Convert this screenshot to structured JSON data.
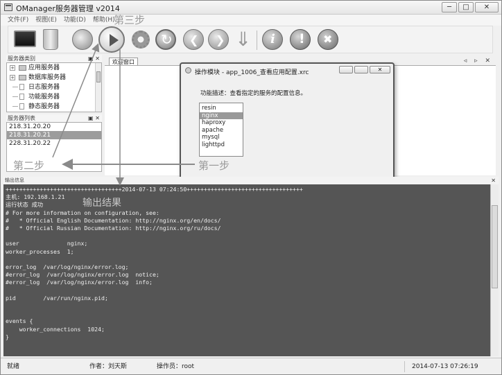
{
  "window": {
    "title": "OManager服务器管理 v2014",
    "controls": [
      "─",
      "□",
      "✕"
    ]
  },
  "menu": [
    "文件(F)",
    "视图(E)",
    "功能(D)",
    "帮助(H)"
  ],
  "toolbar": {
    "icons": [
      "monitor-icon",
      "trash-icon",
      "wrench-icon",
      "play-icon",
      "gear-icon",
      "refresh-icon",
      "back-icon",
      "forward-icon",
      "download-icon",
      "info-icon",
      "warning-icon",
      "stop-icon"
    ]
  },
  "annotations": {
    "step3": "第三步",
    "step2": "第二步",
    "step1": "第一步",
    "result": "输出结果"
  },
  "category_panel": {
    "title": "服务器类别",
    "ctrl": "▣ ✕",
    "items": [
      {
        "label": "应用服务器",
        "expander": "+",
        "type": "folder"
      },
      {
        "label": "数据库服务器",
        "expander": "+",
        "type": "folder"
      },
      {
        "label": "日志服务器",
        "expander": "",
        "type": "leaf"
      },
      {
        "label": "功能服务器",
        "expander": "",
        "type": "leaf"
      },
      {
        "label": "静态服务器",
        "expander": "",
        "type": "leaf"
      }
    ]
  },
  "server_list": {
    "title": "服务器列表",
    "ctrl": "▣ ✕",
    "items": [
      "218.31.20.20",
      "218.31.20.21",
      "228.31.20.22"
    ],
    "selected_index": 1
  },
  "tabs": {
    "active": "欢迎窗口",
    "controls": "◃ ▹ ✕"
  },
  "dialog": {
    "title": "操作模块 - app_1006_查看应用配置.xrc",
    "description": "功能描述：查看指定的服务的配置信息。",
    "close": "✕",
    "items": [
      "resin",
      "nginx",
      "haproxy",
      "apache",
      "mysql",
      "lighttpd"
    ],
    "selected_index": 1
  },
  "output": {
    "title": "输出信息",
    "ctrl": "✕",
    "lines": [
      "++++++++++++++++++++++++++++++++++2014-07-13 07:24:50++++++++++++++++++++++++++++++++++",
      "主机: 192.168.1.21",
      "运行状态 成功",
      "# For more information on configuration, see:",
      "#   * Official English Documentation: http://nginx.org/en/docs/",
      "#   * Official Russian Documentation: http://nginx.org/ru/docs/",
      "",
      "user              nginx;",
      "worker_processes  1;",
      "",
      "error_log  /var/log/nginx/error.log;",
      "#error_log  /var/log/nginx/error.log  notice;",
      "#error_log  /var/log/nginx/error.log  info;",
      "",
      "pid        /var/run/nginx.pid;",
      "",
      "",
      "events {",
      "    worker_connections  1024;",
      "}",
      ""
    ]
  },
  "status": {
    "ready": "就绪",
    "author": "作者：刘天斯",
    "operator": "操作员：root",
    "time": "2014-07-13 07:26:19"
  }
}
